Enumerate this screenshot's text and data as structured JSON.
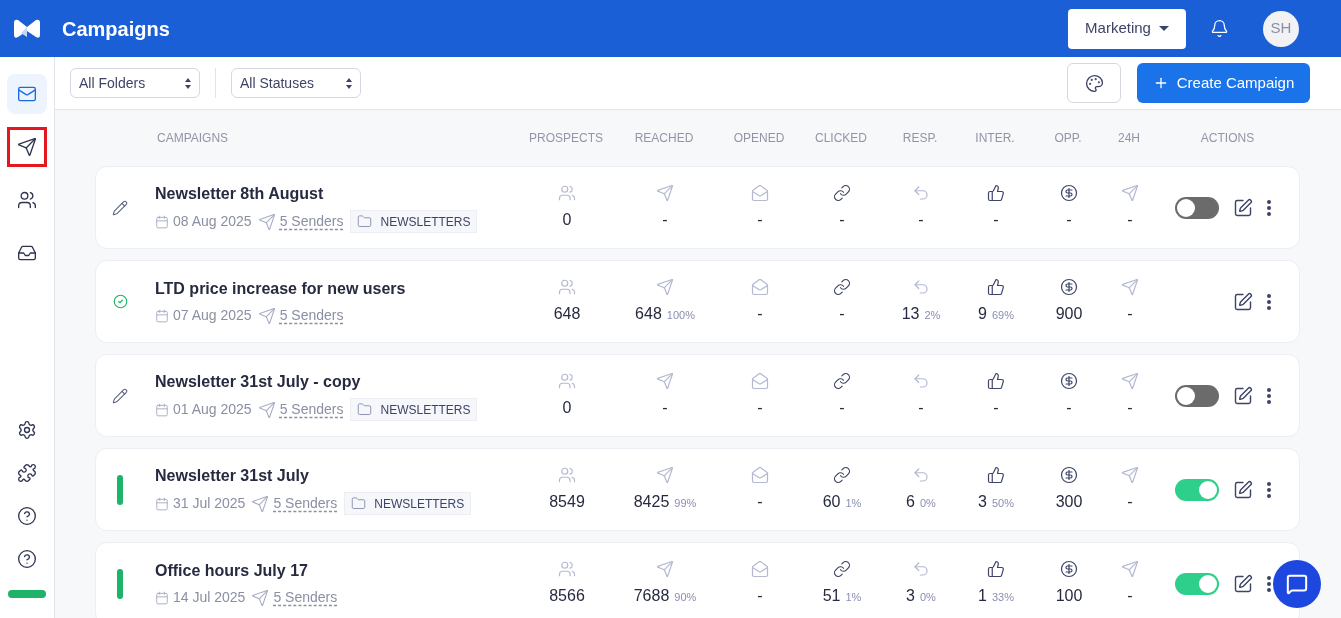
{
  "header": {
    "title": "Campaigns",
    "workspace": "Marketing",
    "avatar": "SH"
  },
  "sidebar": {
    "top": [
      {
        "selected": true,
        "highlighted": false
      },
      {
        "selected": false,
        "highlighted": true
      },
      {
        "selected": false,
        "highlighted": false
      },
      {
        "selected": false,
        "highlighted": false
      }
    ],
    "usage": {
      "level": 1
    }
  },
  "toolbar": {
    "filters": [
      "All Folders",
      "All Statuses"
    ],
    "create_button": "Create Campaign"
  },
  "table": {
    "columns": [
      "CAMPAIGNS",
      "PROSPECTS",
      "REACHED",
      "OPENED",
      "CLICKED",
      "RESP.",
      "INTER.",
      "OPP.",
      "24H",
      "ACTIONS"
    ],
    "rows": [
      {
        "kind": "draft",
        "name": "Newsletter 8th August",
        "date": "08 Aug 2025",
        "senders": "5 Senders",
        "folder": "NEWSLETTERS",
        "toggle": {
          "on": false
        },
        "metrics": [
          {
            "value": "0"
          },
          {
            "value": "-"
          },
          {
            "value": "-"
          },
          {
            "value": "-"
          },
          {
            "value": "-"
          },
          {
            "value": "-"
          },
          {
            "value": "-"
          },
          {
            "value": "-"
          }
        ]
      },
      {
        "kind": "completed",
        "name": "LTD price increase for new users",
        "date": "07 Aug 2025",
        "senders": "5 Senders",
        "metrics": [
          {
            "value": "648"
          },
          {
            "value": "648",
            "pct": "100%"
          },
          {
            "value": "-"
          },
          {
            "value": "-"
          },
          {
            "value": "13",
            "pct": "2%"
          },
          {
            "value": "9",
            "pct": "69%"
          },
          {
            "value": "900"
          },
          {
            "value": "-"
          }
        ]
      },
      {
        "kind": "draft",
        "name": "Newsletter 31st July - copy",
        "date": "01 Aug 2025",
        "senders": "5 Senders",
        "folder": "NEWSLETTERS",
        "toggle": {
          "on": false
        },
        "metrics": [
          {
            "value": "0"
          },
          {
            "value": "-"
          },
          {
            "value": "-"
          },
          {
            "value": "-"
          },
          {
            "value": "-"
          },
          {
            "value": "-"
          },
          {
            "value": "-"
          },
          {
            "value": "-"
          }
        ]
      },
      {
        "kind": "active",
        "name": "Newsletter 31st July",
        "date": "31 Jul 2025",
        "senders": "5 Senders",
        "folder": "NEWSLETTERS",
        "toggle": {
          "on": true
        },
        "metrics": [
          {
            "value": "8549"
          },
          {
            "value": "8425",
            "pct": "99%"
          },
          {
            "value": "-"
          },
          {
            "value": "60",
            "pct": "1%"
          },
          {
            "value": "6",
            "pct": "0%"
          },
          {
            "value": "3",
            "pct": "50%"
          },
          {
            "value": "300"
          },
          {
            "value": "-"
          }
        ]
      },
      {
        "kind": "active",
        "name": "Office hours July 17",
        "date": "14 Jul 2025",
        "senders": "5 Senders",
        "toggle": {
          "on": true
        },
        "metrics": [
          {
            "value": "8566"
          },
          {
            "value": "7688",
            "pct": "90%"
          },
          {
            "value": "-"
          },
          {
            "value": "51",
            "pct": "1%"
          },
          {
            "value": "3",
            "pct": "0%"
          },
          {
            "value": "1",
            "pct": "33%"
          },
          {
            "value": "100"
          },
          {
            "value": "-"
          }
        ]
      }
    ]
  }
}
